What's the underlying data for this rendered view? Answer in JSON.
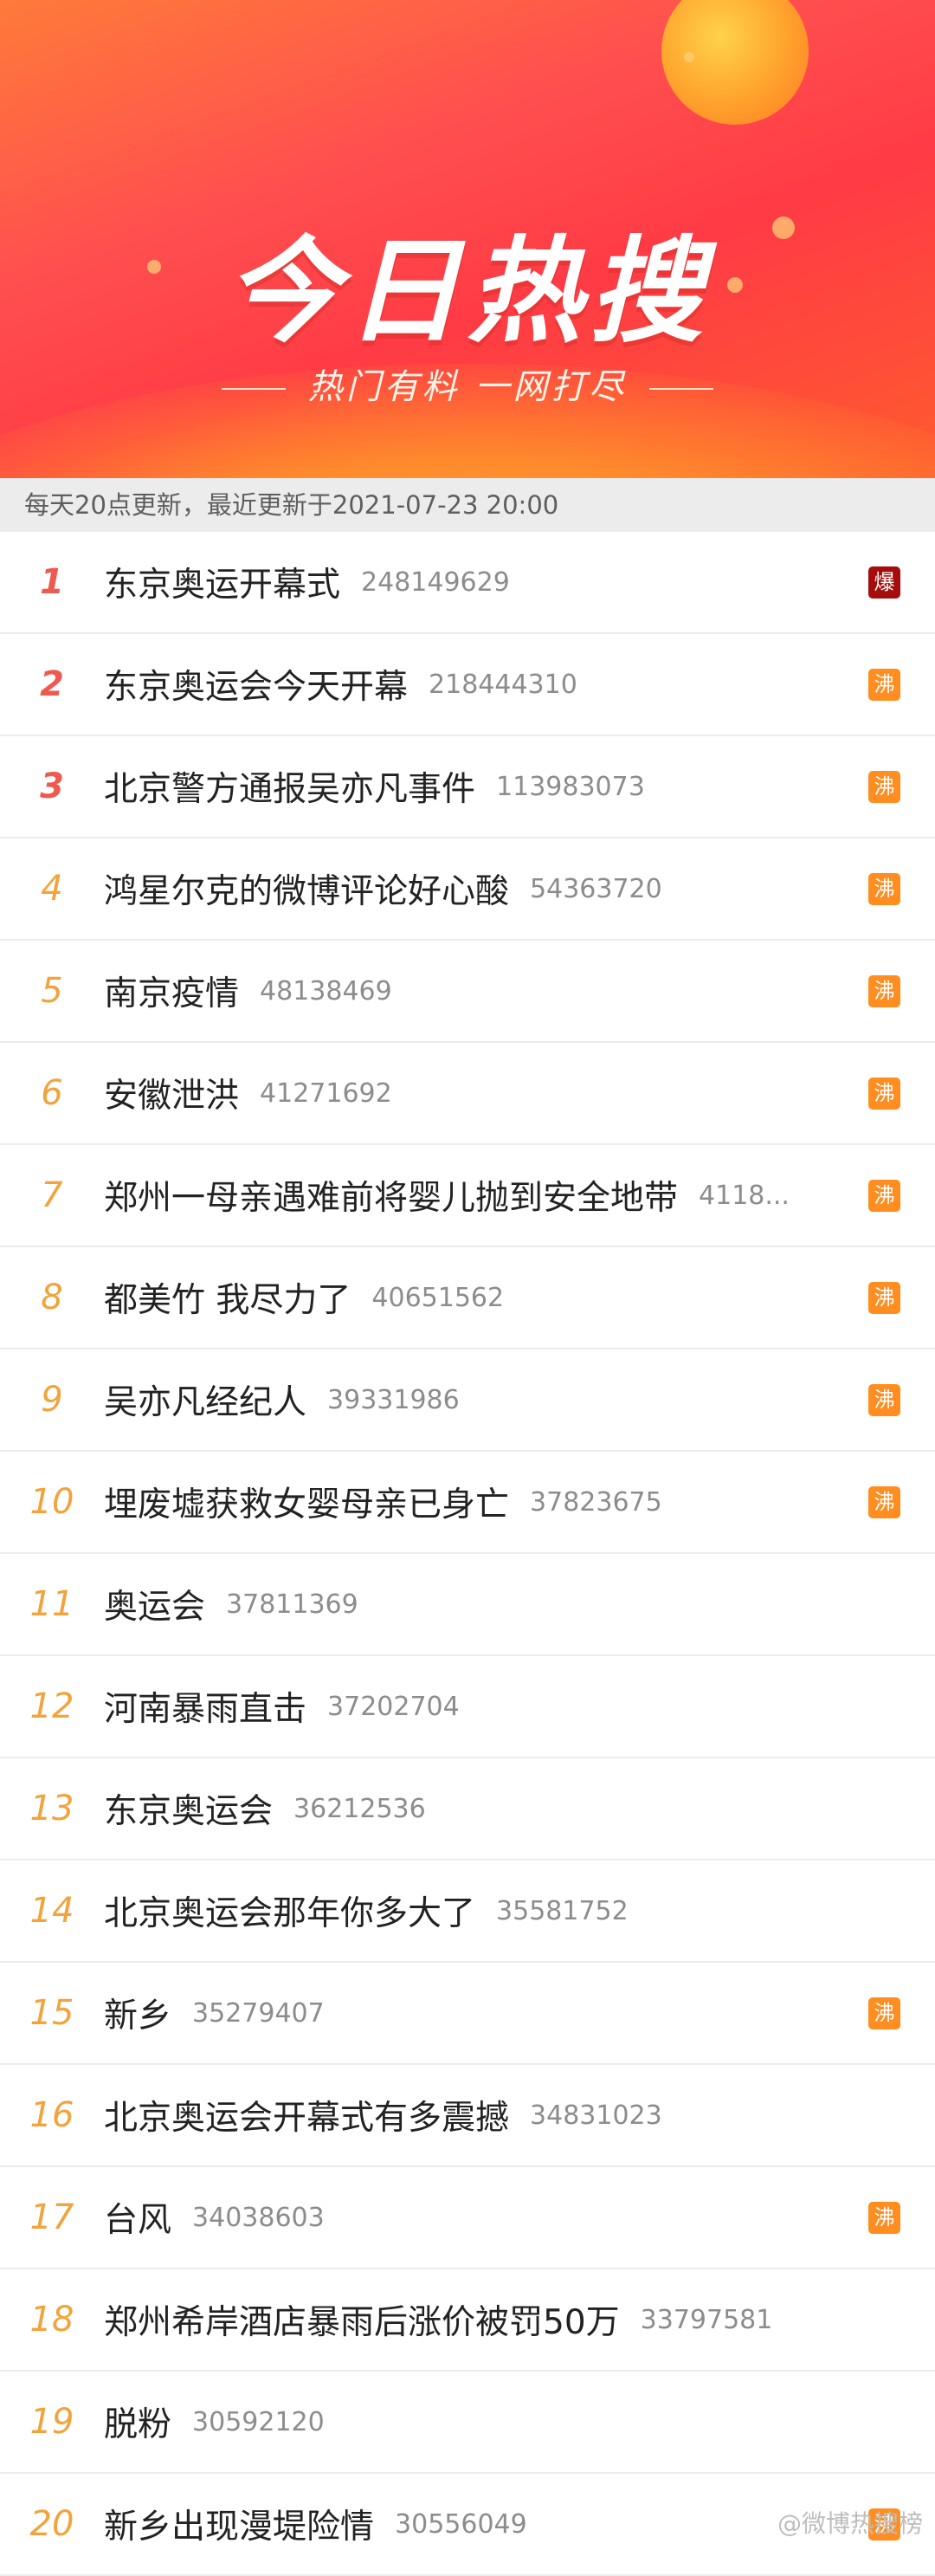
{
  "banner": {
    "title": "今日热搜",
    "subtitle": "热门有料 一网打尽"
  },
  "update_text": "每天20点更新，最近更新于2021-07-23 20:00",
  "items": [
    {
      "rank": "1",
      "text": "东京奥运开幕式",
      "hot": "248149629",
      "badge": "爆"
    },
    {
      "rank": "2",
      "text": "东京奥运会今天开幕",
      "hot": "218444310",
      "badge": "沸"
    },
    {
      "rank": "3",
      "text": "北京警方通报吴亦凡事件",
      "hot": "113983073",
      "badge": "沸"
    },
    {
      "rank": "4",
      "text": "鸿星尔克的微博评论好心酸",
      "hot": "54363720",
      "badge": "沸"
    },
    {
      "rank": "5",
      "text": "南京疫情",
      "hot": "48138469",
      "badge": "沸"
    },
    {
      "rank": "6",
      "text": "安徽泄洪",
      "hot": "41271692",
      "badge": "沸"
    },
    {
      "rank": "7",
      "text": "郑州一母亲遇难前将婴儿抛到安全地带",
      "hot": "4118...",
      "badge": "沸"
    },
    {
      "rank": "8",
      "text": "都美竹 我尽力了",
      "hot": "40651562",
      "badge": "沸"
    },
    {
      "rank": "9",
      "text": "吴亦凡经纪人",
      "hot": "39331986",
      "badge": "沸"
    },
    {
      "rank": "10",
      "text": "埋废墟获救女婴母亲已身亡",
      "hot": "37823675",
      "badge": "沸"
    },
    {
      "rank": "11",
      "text": "奥运会",
      "hot": "37811369",
      "badge": ""
    },
    {
      "rank": "12",
      "text": "河南暴雨直击",
      "hot": "37202704",
      "badge": ""
    },
    {
      "rank": "13",
      "text": "东京奥运会",
      "hot": "36212536",
      "badge": ""
    },
    {
      "rank": "14",
      "text": "北京奥运会那年你多大了",
      "hot": "35581752",
      "badge": ""
    },
    {
      "rank": "15",
      "text": "新乡",
      "hot": "35279407",
      "badge": "沸"
    },
    {
      "rank": "16",
      "text": "北京奥运会开幕式有多震撼",
      "hot": "34831023",
      "badge": ""
    },
    {
      "rank": "17",
      "text": "台风",
      "hot": "34038603",
      "badge": "沸"
    },
    {
      "rank": "18",
      "text": "郑州希岸酒店暴雨后涨价被罚50万",
      "hot": "33797581",
      "badge": ""
    },
    {
      "rank": "19",
      "text": "脱粉",
      "hot": "30592120",
      "badge": ""
    },
    {
      "rank": "20",
      "text": "新乡出现漫堤险情",
      "hot": "30556049",
      "badge": "沸"
    }
  ],
  "watermark": "@微博热搜榜",
  "colors": {
    "rank_top": "#ee5a4f",
    "rank_other": "#f2a33b",
    "badge_bao": "#a50d0d",
    "badge_fei": "#ff8d1f"
  }
}
